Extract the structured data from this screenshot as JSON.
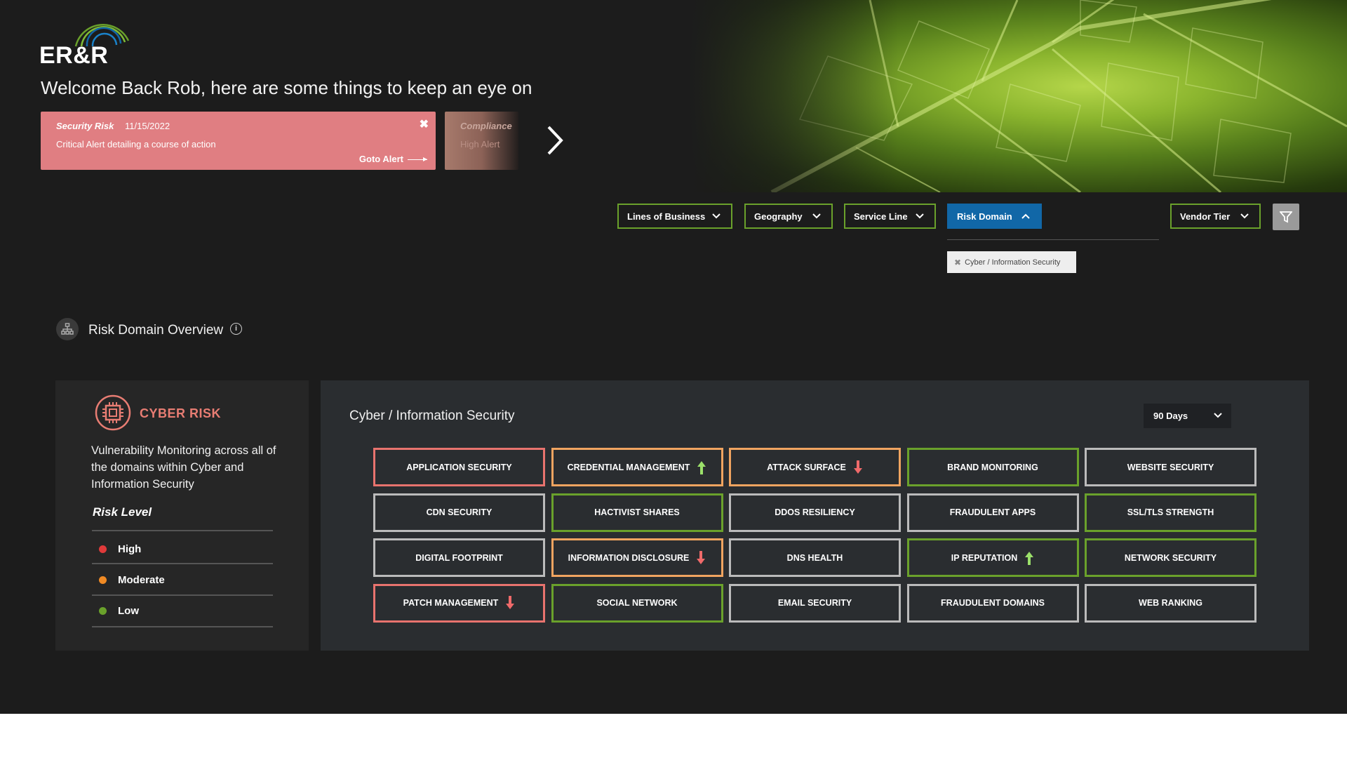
{
  "brand": {
    "logo_text": "ER&R"
  },
  "welcome": "Welcome Back Rob, here are some things to keep an eye on",
  "alerts": [
    {
      "type": "Security Risk",
      "date": "11/15/2022",
      "message": "Critical Alert detailing a course of action",
      "link": "Goto Alert",
      "color": "#e07e82"
    },
    {
      "type": "Compliance",
      "message": "High Alert",
      "color": "#a77a6c"
    }
  ],
  "filters": {
    "lines_of_business": "Lines of Business",
    "geography": "Geography",
    "service_line": "Service Line",
    "risk_domain": "Risk Domain",
    "vendor_tier": "Vendor Tier",
    "selected_chip": "Cyber / Information Security"
  },
  "overview": {
    "title": "Risk Domain Overview",
    "info_glyph": "i"
  },
  "cyber": {
    "title": "CYBER RISK",
    "description": "Vulnerability Monitoring across all of the domains within Cyber and Information Security",
    "risk_level_label": "Risk Level",
    "levels": [
      {
        "label": "High",
        "color": "#e03a3a"
      },
      {
        "label": "Moderate",
        "color": "#f08a24"
      },
      {
        "label": "Low",
        "color": "#6aa12b"
      }
    ]
  },
  "panel": {
    "title": "Cyber / Information Security",
    "period": "90 Days"
  },
  "colors": {
    "high": "#e8736e",
    "moderate": "#f0a460",
    "low": "#6aa12b",
    "neutral": "#bbbbbb",
    "trend_up": "#9be06a",
    "trend_down": "#f06a6a"
  },
  "tiles": [
    {
      "label": "Application Security",
      "status": "high",
      "trend": ""
    },
    {
      "label": "Credential Management",
      "status": "moderate",
      "trend": "up"
    },
    {
      "label": "Attack Surface",
      "status": "moderate",
      "trend": "down"
    },
    {
      "label": "Brand Monitoring",
      "status": "low",
      "trend": ""
    },
    {
      "label": "Website Security",
      "status": "neutral",
      "trend": ""
    },
    {
      "label": "CDN Security",
      "status": "neutral",
      "trend": ""
    },
    {
      "label": "Hactivist Shares",
      "status": "low",
      "trend": ""
    },
    {
      "label": "DDOS Resiliency",
      "status": "neutral",
      "trend": ""
    },
    {
      "label": "Fraudulent Apps",
      "status": "neutral",
      "trend": ""
    },
    {
      "label": "SSL/TLS Strength",
      "status": "low",
      "trend": ""
    },
    {
      "label": "Digital Footprint",
      "status": "neutral",
      "trend": ""
    },
    {
      "label": "Information Disclosure",
      "status": "moderate",
      "trend": "down"
    },
    {
      "label": "DNS Health",
      "status": "neutral",
      "trend": ""
    },
    {
      "label": "IP Reputation",
      "status": "low",
      "trend": "up"
    },
    {
      "label": "Network Security",
      "status": "low",
      "trend": ""
    },
    {
      "label": "Patch Management",
      "status": "high",
      "trend": "down"
    },
    {
      "label": "Social Network",
      "status": "low",
      "trend": ""
    },
    {
      "label": "Email Security",
      "status": "neutral",
      "trend": ""
    },
    {
      "label": "Fraudulent Domains",
      "status": "neutral",
      "trend": ""
    },
    {
      "label": "Web Ranking",
      "status": "neutral",
      "trend": ""
    }
  ]
}
